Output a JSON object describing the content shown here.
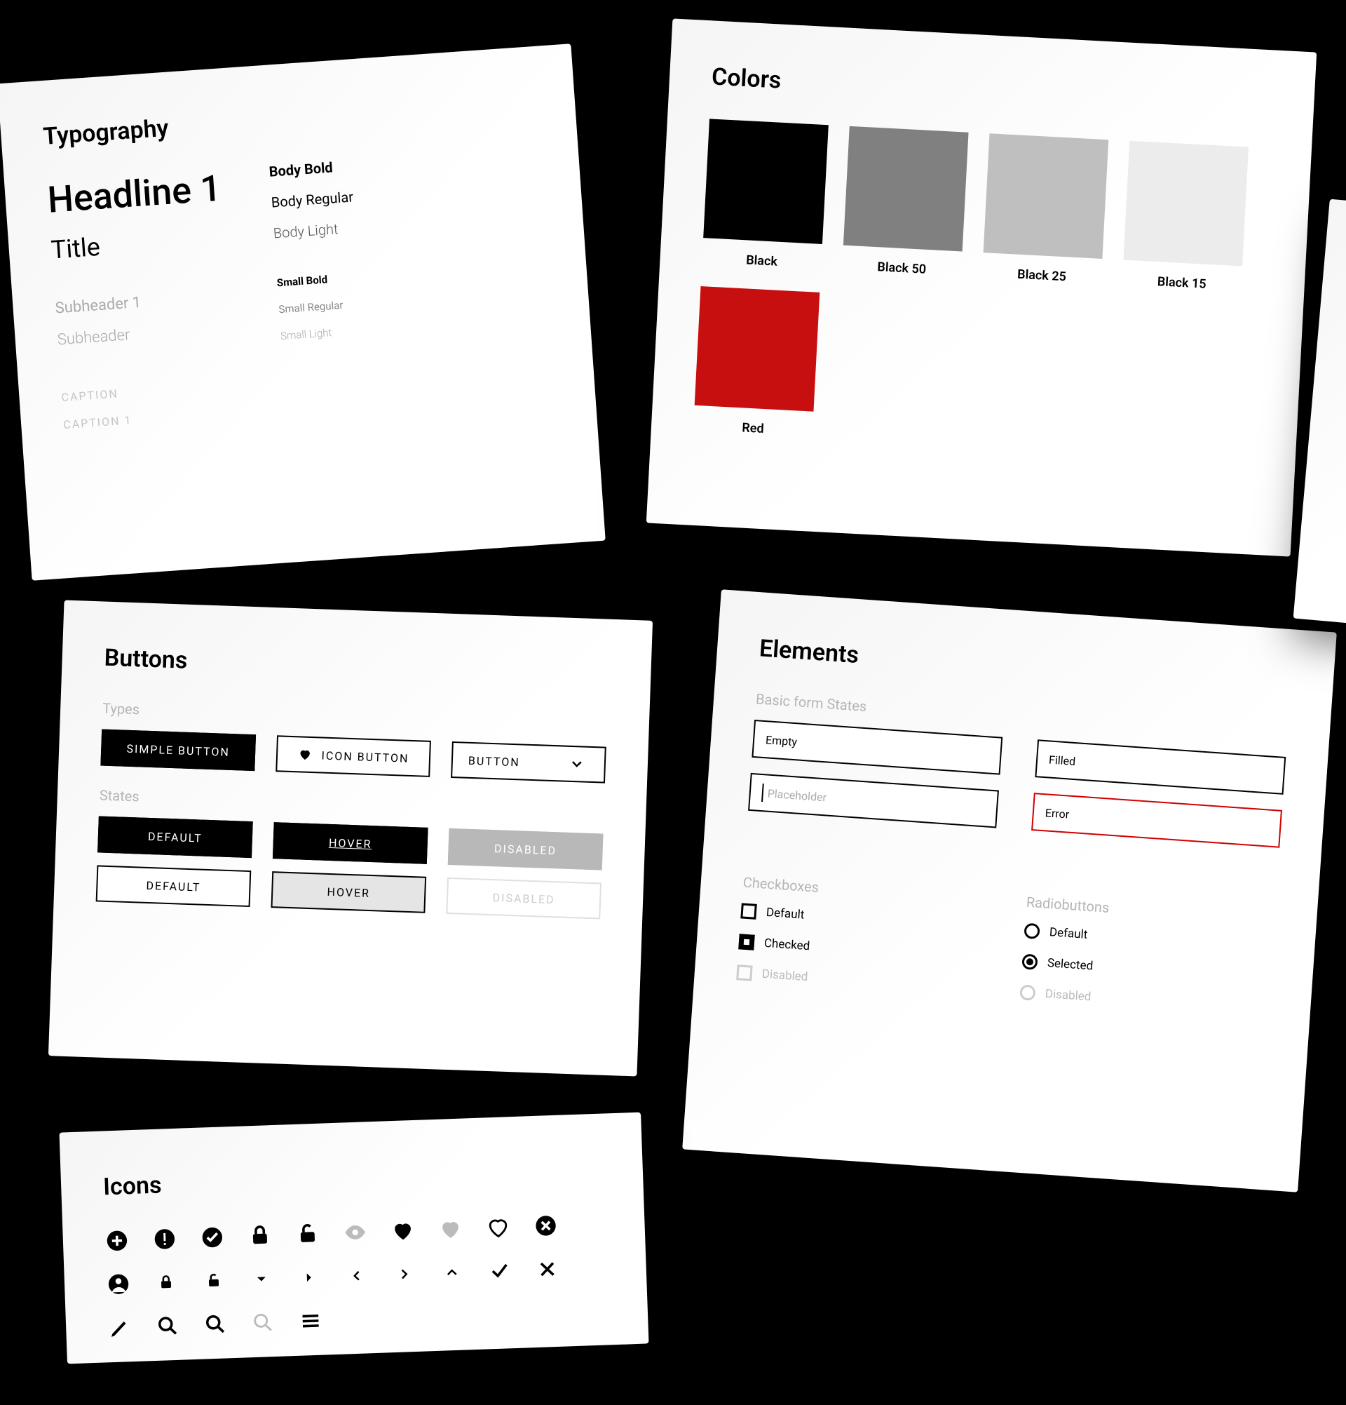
{
  "typography": {
    "title": "Typography",
    "left": {
      "headline1": "Headline 1",
      "title": "Title",
      "subheader1": "Subheader 1",
      "subheader": "Subheader",
      "caption": "CAPTION",
      "caption1": "CAPTION 1"
    },
    "right": {
      "body_bold": "Body Bold",
      "body_regular": "Body Regular",
      "body_light": "Body Light",
      "small_bold": "Small Bold",
      "small_regular": "Small Regular",
      "small_light": "Small Light"
    }
  },
  "colors": {
    "title": "Colors",
    "swatches": [
      {
        "name": "Black",
        "hex": "#000000"
      },
      {
        "name": "Black 50",
        "hex": "#808080"
      },
      {
        "name": "Black 25",
        "hex": "#BFBFBF"
      },
      {
        "name": "Black 15",
        "hex": "#ECECEC"
      },
      {
        "name": "Red",
        "hex": "#C70F0F"
      }
    ]
  },
  "buttons": {
    "title": "Buttons",
    "types_label": "Types",
    "states_label": "States",
    "simple": "SIMPLE BUTTON",
    "icon": "ICON BUTTON",
    "dropdown": "BUTTON",
    "default": "DEFAULT",
    "hover": "HOVER",
    "disabled": "DISABLED"
  },
  "elements": {
    "title": "Elements",
    "form_states_label": "Basic form States",
    "empty": "Empty",
    "filled": "Filled",
    "placeholder": "Placeholder",
    "error": "Error",
    "checkboxes_label": "Checkboxes",
    "checkbox_default": "Default",
    "checkbox_checked": "Checked",
    "checkbox_disabled": "Disabled",
    "radios_label": "Radiobuttons",
    "radio_default": "Default",
    "radio_selected": "Selected",
    "radio_disabled": "Disabled"
  },
  "icons": {
    "title": "Icons",
    "list": [
      "plus-circle-icon",
      "alert-circle-icon",
      "check-circle-icon",
      "lock-icon",
      "lock-open-icon",
      "eye-icon",
      "heart-filled-icon",
      "heart-grey-icon",
      "heart-outline-icon",
      "x-circle-icon",
      "user-circle-icon",
      "lock-small-icon",
      "lock-open-small-icon",
      "caret-down-icon",
      "caret-right-icon",
      "chevron-left-icon",
      "chevron-right-icon",
      "chevron-up-icon",
      "check-icon",
      "close-icon",
      "pencil-icon",
      "search-icon",
      "zoom-in-icon",
      "zoom-light-icon",
      "menu-icon"
    ]
  }
}
